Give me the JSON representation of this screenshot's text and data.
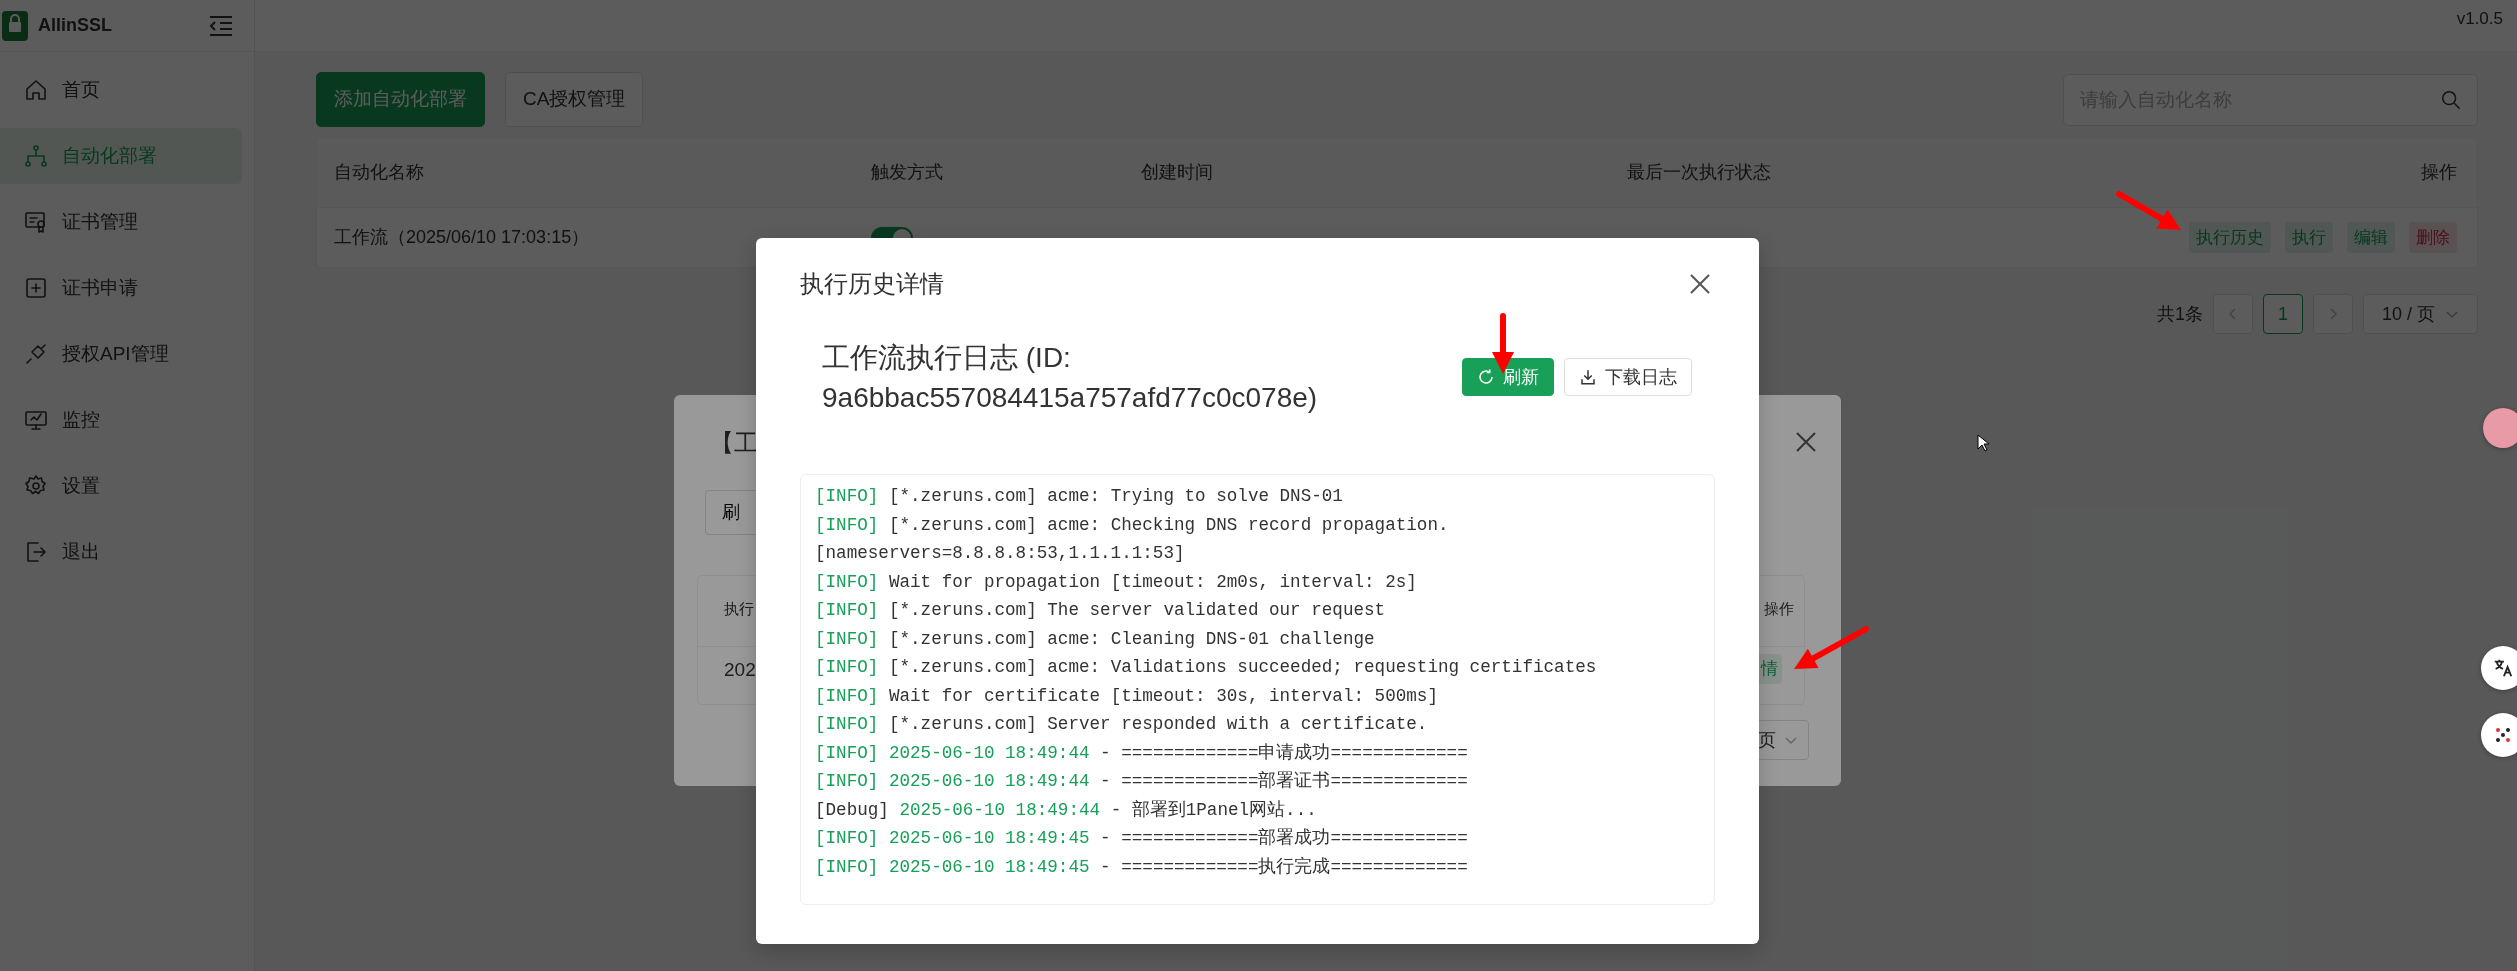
{
  "app": {
    "name": "AllinSSL",
    "version": "v1.0.5"
  },
  "sidebar": {
    "items": [
      {
        "label": "首页",
        "selected": false
      },
      {
        "label": "自动化部署",
        "selected": true
      },
      {
        "label": "证书管理",
        "selected": false
      },
      {
        "label": "证书申请",
        "selected": false
      },
      {
        "label": "授权API管理",
        "selected": false
      },
      {
        "label": "监控",
        "selected": false
      },
      {
        "label": "设置",
        "selected": false
      },
      {
        "label": "退出",
        "selected": false
      }
    ]
  },
  "toolbar": {
    "buttons": [
      {
        "label": "添加自动化部署",
        "kind": "primary"
      },
      {
        "label": "CA授权管理",
        "kind": "default"
      }
    ],
    "search": {
      "placeholder": "请输入自动化名称"
    }
  },
  "table": {
    "columns": [
      "自动化名称",
      "触发方式",
      "创建时间",
      "最后一次执行状态",
      "操作"
    ],
    "rows": [
      {
        "name": "工作流（2025/06/10 17:03:15）",
        "trigger_on": true,
        "actions": [
          {
            "label": "执行历史",
            "kind": "primary"
          },
          {
            "label": "执行",
            "kind": "primary"
          },
          {
            "label": "编辑",
            "kind": "primary"
          },
          {
            "label": "删除",
            "kind": "danger"
          }
        ]
      }
    ]
  },
  "pagination": {
    "total": "共1条",
    "pages": [
      {
        "label": "1",
        "selected": true
      }
    ],
    "page_size": "10 / 页"
  },
  "background_dialog": {
    "title": "【工",
    "button": "刷",
    "columns": [
      "执行",
      "操作"
    ],
    "row": {
      "cell_1": "202",
      "action": "情"
    },
    "page_size": "页"
  },
  "modal": {
    "title": "执行历史详情",
    "log_title": "工作流执行日志 (ID: 9a6bbac557084415a757afd77c0c078e)",
    "buttons": [
      {
        "label": "刷新",
        "kind": "primary"
      },
      {
        "label": "下载日志",
        "kind": "default"
      }
    ],
    "log": [
      {
        "kind": "info",
        "tag": "[INFO]",
        "message": "[*.zeruns.com] acme: Trying to solve DNS-01"
      },
      {
        "kind": "info",
        "tag": "[INFO]",
        "message": "[*.zeruns.com] acme: Checking DNS record propagation. [nameservers=8.8.8.8:53,1.1.1.1:53]"
      },
      {
        "kind": "info",
        "tag": "[INFO]",
        "message": "Wait for propagation [timeout: 2m0s, interval: 2s]"
      },
      {
        "kind": "info",
        "tag": "[INFO]",
        "message": "[*.zeruns.com] The server validated our request"
      },
      {
        "kind": "info",
        "tag": "[INFO]",
        "message": "[*.zeruns.com] acme: Cleaning DNS-01 challenge"
      },
      {
        "kind": "info",
        "tag": "[INFO]",
        "message": "[*.zeruns.com] acme: Validations succeeded; requesting certificates"
      },
      {
        "kind": "info",
        "tag": "[INFO]",
        "message": "Wait for certificate [timeout: 30s, interval: 500ms]"
      },
      {
        "kind": "info",
        "tag": "[INFO]",
        "message": "[*.zeruns.com] Server responded with a certificate."
      },
      {
        "kind": "info",
        "tag": "[INFO]",
        "time": "2025-06-10 18:49:44",
        "message": "- =============申请成功============="
      },
      {
        "kind": "info",
        "tag": "[INFO]",
        "time": "2025-06-10 18:49:44",
        "message": "- =============部署证书============="
      },
      {
        "kind": "debug",
        "tag": "[Debug]",
        "time": "2025-06-10 18:49:44",
        "message": "- 部署到1Panel网站..."
      },
      {
        "kind": "info",
        "tag": "[INFO]",
        "time": "2025-06-10 18:49:45",
        "message": "- =============部署成功============="
      },
      {
        "kind": "info",
        "tag": "[INFO]",
        "time": "2025-06-10 18:49:45",
        "message": "- =============执行完成============="
      }
    ]
  }
}
